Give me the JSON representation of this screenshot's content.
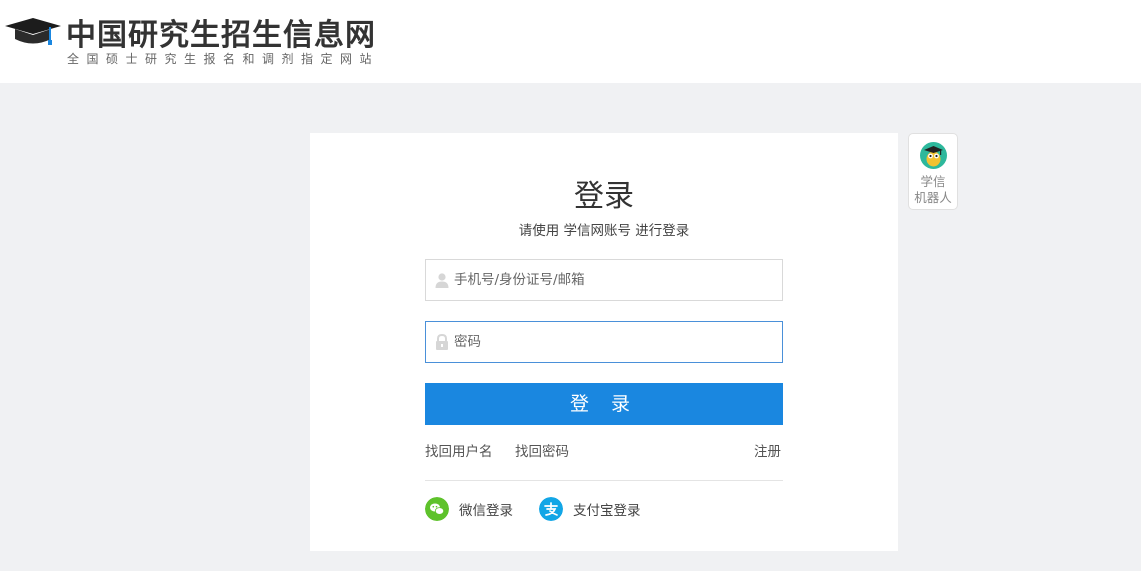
{
  "header": {
    "title": "中国研究生招生信息网",
    "subtitle": "全国硕士研究生报名和调剂指定网站"
  },
  "login": {
    "title": "登录",
    "subtitle": "请使用 学信网账号 进行登录",
    "username_placeholder": "手机号/身份证号/邮箱",
    "password_placeholder": "密码",
    "submit_label": "登 录",
    "forgot_username": "找回用户名",
    "forgot_password": "找回密码",
    "register": "注册"
  },
  "social": {
    "wechat_label": "微信登录",
    "alipay_label": "支付宝登录"
  },
  "robot": {
    "line1": "学信",
    "line2": "机器人"
  },
  "colors": {
    "primary": "#1a87e0",
    "wechat": "#5ec22b",
    "alipay": "#12a6e6",
    "page_bg": "#f0f1f3"
  },
  "icons": {
    "logo": "graduation-cap-icon",
    "username": "user-icon",
    "password": "lock-icon",
    "wechat": "wechat-icon",
    "alipay": "alipay-icon",
    "robot": "robot-avatar-icon"
  }
}
